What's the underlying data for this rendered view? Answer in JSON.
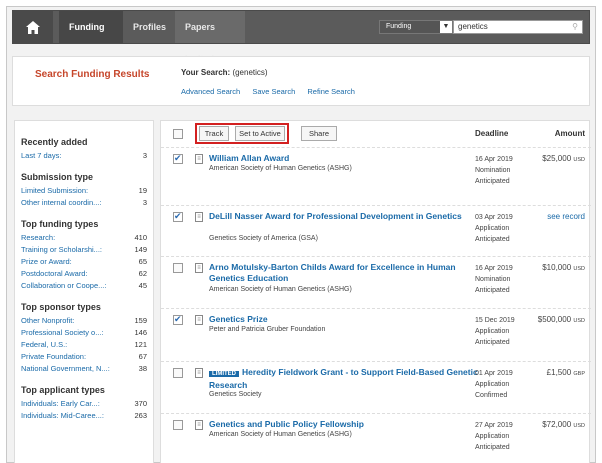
{
  "nav": {
    "tabs": [
      "Funding",
      "Profiles",
      "Papers Invited"
    ],
    "search_type": "Funding",
    "search_value": "genetics"
  },
  "header": {
    "title": "Search Funding Results",
    "your_search_label": "Your Search:",
    "your_search_value": "(genetics)",
    "links": [
      "Advanced Search",
      "Save Search",
      "Refine Search"
    ]
  },
  "sidebar": {
    "sections": [
      {
        "title": "Recently added",
        "items": [
          {
            "label": "Last 7 days:",
            "count": "3"
          }
        ]
      },
      {
        "title": "Submission type",
        "items": [
          {
            "label": "Limited Submission:",
            "count": "19"
          },
          {
            "label": "Other internal coordin...:",
            "count": "3"
          }
        ]
      },
      {
        "title": "Top funding types",
        "items": [
          {
            "label": "Research:",
            "count": "410"
          },
          {
            "label": "Training or Scholarshi...:",
            "count": "149"
          },
          {
            "label": "Prize or Award:",
            "count": "65"
          },
          {
            "label": "Postdoctoral Award:",
            "count": "62"
          },
          {
            "label": "Collaboration or Coope...:",
            "count": "45"
          }
        ]
      },
      {
        "title": "Top sponsor types",
        "items": [
          {
            "label": "Other Nonprofit:",
            "count": "159"
          },
          {
            "label": "Professional Society o...:",
            "count": "146"
          },
          {
            "label": "Federal, U.S.:",
            "count": "121"
          },
          {
            "label": "Private Foundation:",
            "count": "67"
          },
          {
            "label": "National Government, N...:",
            "count": "38"
          }
        ]
      },
      {
        "title": "Top applicant types",
        "items": [
          {
            "label": "Individuals: Early Car...:",
            "count": "370"
          },
          {
            "label": "Individuals: Mid-Caree...:",
            "count": "263"
          }
        ]
      }
    ]
  },
  "toolbar": {
    "track_label": "Track",
    "set_active_label": "Set to Active",
    "share_label": "Share",
    "deadline_header": "Deadline",
    "amount_header": "Amount"
  },
  "results": [
    {
      "checked": true,
      "badge": "",
      "title": "William Allan Award",
      "org": "American Society of Human Genetics (ASHG)",
      "date": "16 Apr 2019",
      "stage": "Nomination",
      "status": "Anticipated",
      "amount": "$25,000",
      "currency": "USD"
    },
    {
      "checked": true,
      "badge": "",
      "title": "DeLill Nasser Award for Professional Development in Genetics",
      "org": "Genetics Society of America (GSA)",
      "date": "03 Apr 2019",
      "stage": "Application",
      "status": "Anticipated",
      "amount": "see record",
      "currency": ""
    },
    {
      "checked": false,
      "badge": "",
      "title": "Arno Motulsky-Barton Childs Award for Excellence in Human Genetics Education",
      "org": "American Society of Human Genetics (ASHG)",
      "date": "16 Apr 2019",
      "stage": "Nomination",
      "status": "Anticipated",
      "amount": "$10,000",
      "currency": "USD"
    },
    {
      "checked": true,
      "badge": "",
      "title": "Genetics Prize",
      "org": "Peter and Patricia Gruber Foundation",
      "date": "15 Dec 2019",
      "stage": "Application",
      "status": "Anticipated",
      "amount": "$500,000",
      "currency": "USD"
    },
    {
      "checked": false,
      "badge": "LIMITED",
      "title": "Heredity Fieldwork Grant - to Support Field-Based Genetic Research",
      "org": "Genetics Society",
      "date": "01 Apr 2019",
      "stage": "Application",
      "status": "Confirmed",
      "amount": "£1,500",
      "currency": "GBP"
    },
    {
      "checked": false,
      "badge": "",
      "title": "Genetics and Public Policy Fellowship",
      "org": "American Society of Human Genetics (ASHG)",
      "date": "27 Apr 2019",
      "stage": "Application",
      "status": "Anticipated",
      "amount": "$72,000",
      "currency": "USD"
    }
  ]
}
